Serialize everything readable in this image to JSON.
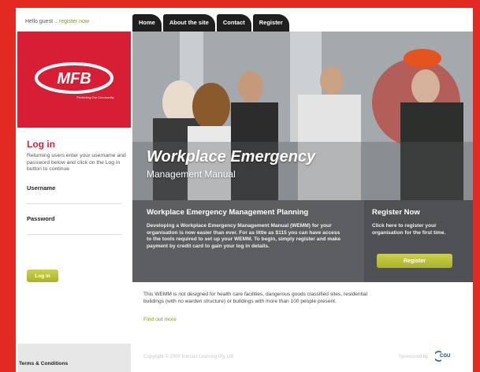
{
  "greeting": {
    "prefix": "Hello guest ..",
    "register_link": "register now"
  },
  "nav": {
    "tabs": [
      "Home",
      "About the site",
      "Contact",
      "Register"
    ]
  },
  "logo": {
    "text": "MFB",
    "tagline": "Protecting Our Community"
  },
  "hero": {
    "title": "Workplace Emergency",
    "subtitle": "Management Manual"
  },
  "planning": {
    "heading": "Workplace Emergency Management Planning",
    "body": "Developing a Workplace Emergency Management Manual (WEMM) for your organisation is now easier than ever. For as little as $115 you can have access to the tools required to set up your WEMM. To begin, simply register and make payment by credit card to gain your log in details."
  },
  "register_box": {
    "heading": "Register Now",
    "body": "Click here to register your organisation for the first time.",
    "button": "Register"
  },
  "login": {
    "heading": "Log in",
    "intro": "Returning users enter your username and password below and click on the Log in button to continue",
    "username_label": "Username",
    "password_label": "Password",
    "button": "Log in"
  },
  "disclaimer": "This WEMM is not designed for health care facilities, dangerous goods classified sites, residential buildings (with no warden structure) or buildings with more than 100 people present.",
  "find_out_more": "Find out more",
  "footer": {
    "terms": "Terms & Conditions",
    "copyright": "Copyright © 2009 Interact Learning Pty Ltd",
    "sponsored": "Sponsored by",
    "sponsor": "CGU"
  },
  "colors": {
    "frame": "#e02a22",
    "brand_red": "#d81e35",
    "accent_green": "#a9b22a",
    "panel": "#5c5e61"
  },
  "icons": [
    "mfb-logo",
    "cgu-logo"
  ]
}
